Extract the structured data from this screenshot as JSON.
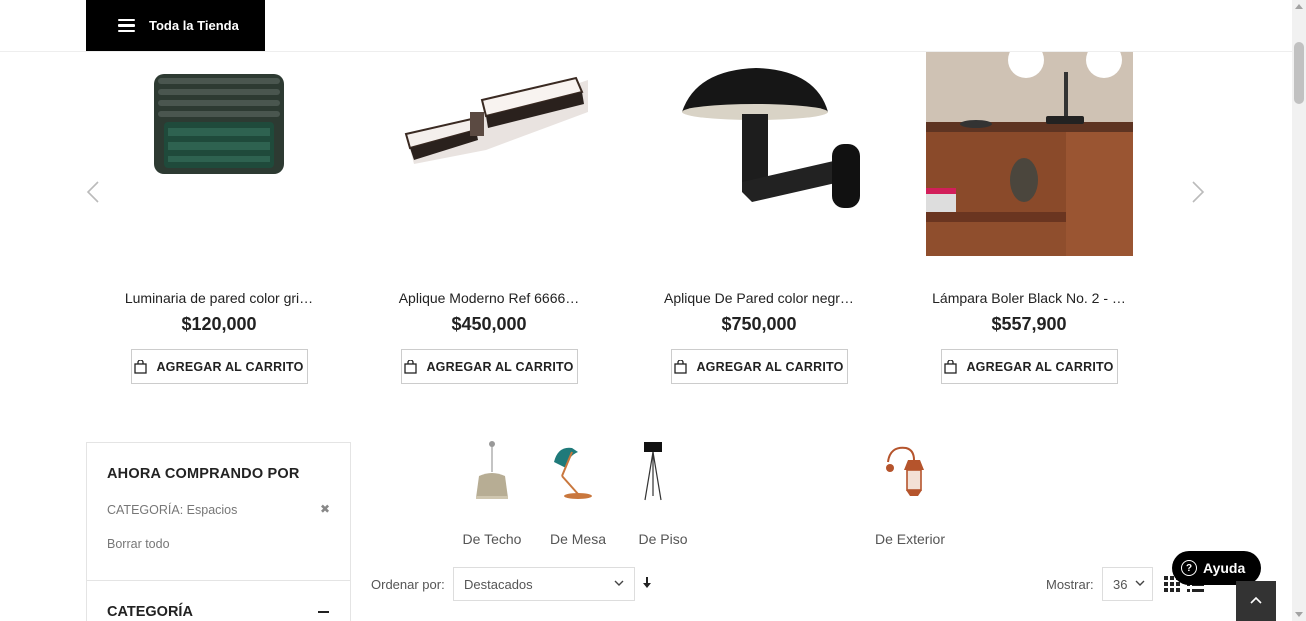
{
  "header": {
    "all_store_label": "Toda la Tienda"
  },
  "carousel": {
    "products": [
      {
        "name": "Luminaria de pared color gri…",
        "price": "$120,000",
        "cart_label": "AGREGAR AL CARRITO"
      },
      {
        "name": "Aplique Moderno Ref 6666…",
        "price": "$450,000",
        "cart_label": "AGREGAR AL CARRITO"
      },
      {
        "name": "Aplique De Pared color negr…",
        "price": "$750,000",
        "cart_label": "AGREGAR AL CARRITO"
      },
      {
        "name": "Lámpara Boler Black No. 2 - …",
        "price": "$557,900",
        "cart_label": "AGREGAR AL CARRITO"
      }
    ]
  },
  "sidebar": {
    "title": "AHORA COMPRANDO POR",
    "filter_label": "CATEGORÍA:",
    "filter_value": "Espacios",
    "remove_glyph": "✖",
    "clear_all": "Borrar todo",
    "category_title": "CATEGORÍA"
  },
  "subcategories": [
    {
      "label": "De Techo"
    },
    {
      "label": "De Mesa"
    },
    {
      "label": "De Piso"
    },
    {
      "label": "De Exterior"
    }
  ],
  "toolbar": {
    "sort_label": "Ordenar por:",
    "sort_value": "Destacados",
    "show_label": "Mostrar:",
    "show_value": "36"
  },
  "help": {
    "label": "Ayuda"
  },
  "colors": {
    "black": "#000000",
    "text": "#222222",
    "muted": "#777777"
  }
}
